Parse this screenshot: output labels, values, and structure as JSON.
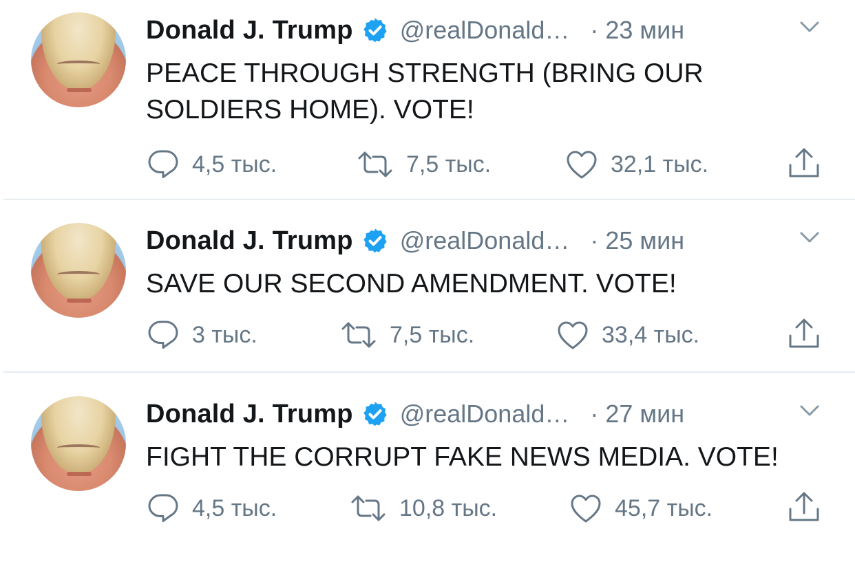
{
  "tweets": [
    {
      "author_name": "Donald J. Trump",
      "handle": "@realDonald…",
      "time": "23 мин",
      "text": "PEACE THROUGH STRENGTH (BRING OUR\nSOLDIERS HOME). VOTE!",
      "replies": "4,5 тыс.",
      "retweets": "7,5 тыс.",
      "likes": "32,1 тыс."
    },
    {
      "author_name": "Donald J. Trump",
      "handle": "@realDonald…",
      "time": "25 мин",
      "text": "SAVE OUR SECOND AMENDMENT. VOTE!",
      "replies": "3 тыс.",
      "retweets": "7,5 тыс.",
      "likes": "33,4 тыс."
    },
    {
      "author_name": "Donald J. Trump",
      "handle": "@realDonald…",
      "time": "27 мин",
      "text": "FIGHT THE CORRUPT FAKE NEWS MEDIA. VOTE!",
      "replies": "4,5 тыс.",
      "retweets": "10,8 тыс.",
      "likes": "45,7 тыс."
    }
  ],
  "separator": "·",
  "colors": {
    "verified": "#1da1f2",
    "secondary_text": "#657786",
    "primary_text": "#14171a",
    "divider": "#e6ecf0"
  },
  "icons": [
    "verified-badge-icon",
    "chevron-down-icon",
    "reply-icon",
    "retweet-icon",
    "like-icon",
    "share-icon"
  ]
}
